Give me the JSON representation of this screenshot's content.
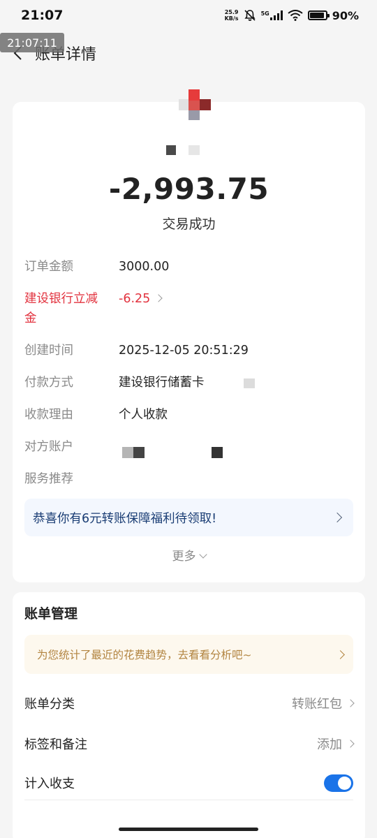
{
  "status_bar": {
    "time": "21:07",
    "net_speed_value": "25.9",
    "net_speed_unit": "KB/s",
    "signal_label": "5G",
    "battery_percent": "90%",
    "battery_level": 0.9
  },
  "overlay_time": "21:07:11",
  "nav": {
    "title": "账单详情"
  },
  "summary": {
    "amount": "-2,993.75",
    "status": "交易成功"
  },
  "details": [
    {
      "label": "订单金额",
      "value": "3000.00"
    },
    {
      "label": "建设银行立减金",
      "value": "-6.25"
    },
    {
      "label": "创建时间",
      "value": "2025-12-05 20:51:29"
    },
    {
      "label": "付款方式",
      "value": "建设银行储蓄卡"
    },
    {
      "label": "收款理由",
      "value": "个人收款"
    },
    {
      "label": "对方账户",
      "value": ""
    },
    {
      "label": "服务推荐",
      "value": ""
    }
  ],
  "promo": {
    "text": "恭喜你有6元转账保障福利待领取!"
  },
  "more": {
    "label": "更多"
  },
  "manage": {
    "title": "账单管理",
    "trend_text": "为您统计了最近的花费趋势，去看看分析吧~",
    "rows": [
      {
        "label": "账单分类",
        "value": "转账红包"
      },
      {
        "label": "标签和备注",
        "value": "添加"
      },
      {
        "label": "计入收支",
        "value": ""
      }
    ],
    "toggle_on": true
  },
  "colors": {
    "accent_blue": "#1a73e8",
    "red": "#e2333f",
    "gold": "#b28440"
  }
}
